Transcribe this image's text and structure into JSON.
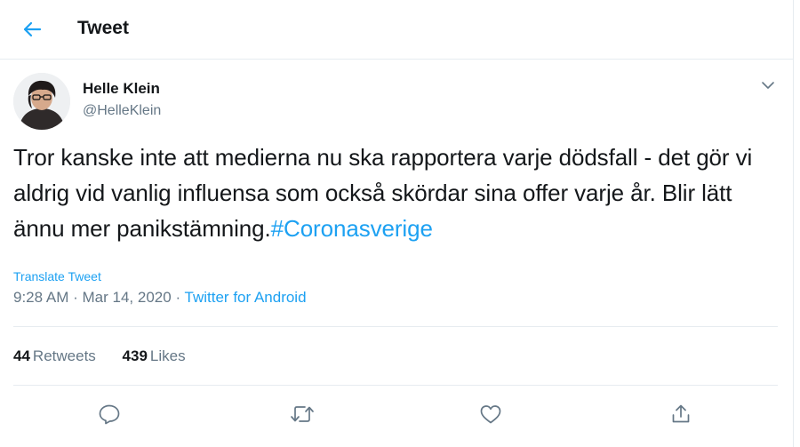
{
  "header": {
    "title": "Tweet",
    "back_icon": "arrow-left-icon"
  },
  "author": {
    "name": "Helle Klein",
    "handle": "@HelleKlein",
    "avatar": "avatar-photo"
  },
  "tweet": {
    "text": "Tror kanske inte att medierna nu ska rapportera varje dödsfall - det gör vi aldrig vid vanlig influensa som också skördar sina offer varje år. Blir lätt ännu mer panikstämning.",
    "hashtag": "#Coronasverige",
    "translate_label": "Translate Tweet",
    "time": "9:28 AM",
    "date": "Mar 14, 2020",
    "separator": "·",
    "source": "Twitter for Android"
  },
  "stats": {
    "retweets_count": "44",
    "retweets_label": "Retweets",
    "likes_count": "439",
    "likes_label": "Likes"
  },
  "actions": {
    "reply_icon": "reply-icon",
    "retweet_icon": "retweet-icon",
    "like_icon": "heart-icon",
    "share_icon": "share-icon"
  },
  "colors": {
    "accent": "#1da1f2",
    "text": "#14171a",
    "secondary": "#657786",
    "border": "#e6ecf0"
  }
}
